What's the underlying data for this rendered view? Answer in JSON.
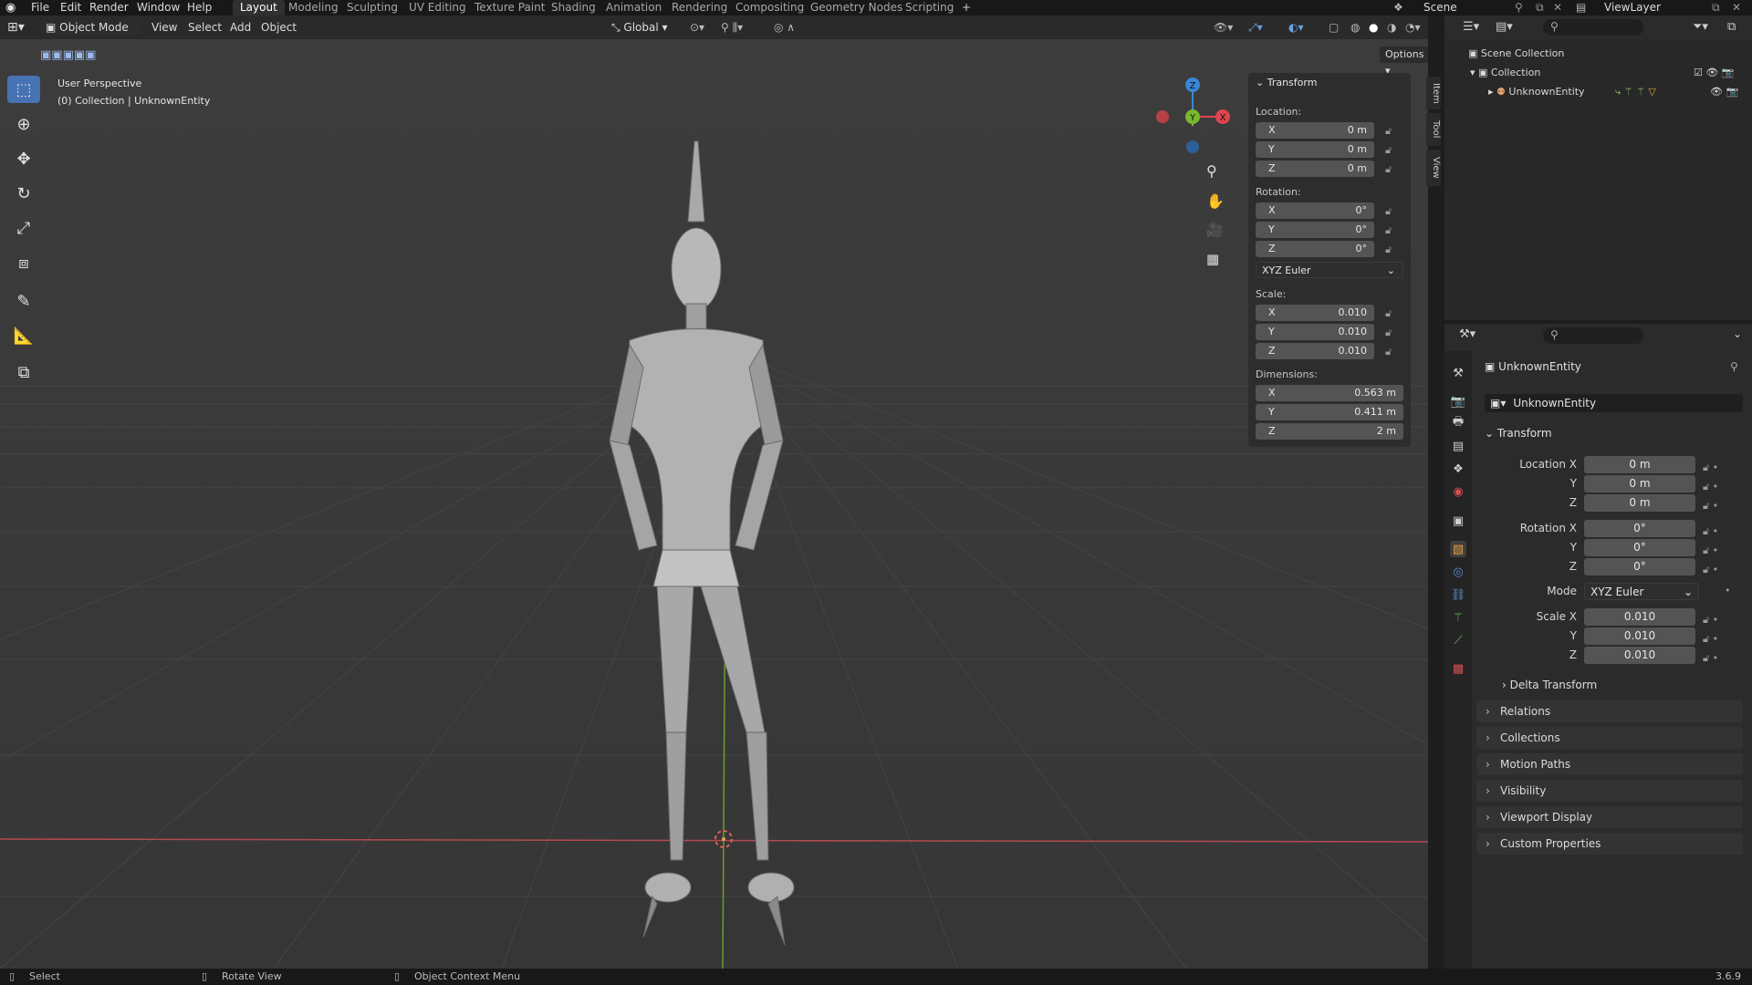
{
  "menu": {
    "items": [
      "File",
      "Edit",
      "Render",
      "Window",
      "Help"
    ],
    "workspaces": [
      "Layout",
      "Modeling",
      "Sculpting",
      "UV Editing",
      "Texture Paint",
      "Shading",
      "Animation",
      "Rendering",
      "Compositing",
      "Geometry Nodes",
      "Scripting"
    ],
    "active_workspace": "Layout",
    "add_tab": "+",
    "scene": "Scene",
    "view_layer": "ViewLayer"
  },
  "viewport_header": {
    "mode": "Object Mode",
    "view": "View",
    "select": "Select",
    "add": "Add",
    "object": "Object",
    "orientation": "Global",
    "options": "Options"
  },
  "viewport": {
    "perspective": "User Perspective",
    "collection_info": "(0) Collection | UnknownEntity"
  },
  "gizmo": {
    "x": "X",
    "y": "Y",
    "z": "Z"
  },
  "npanel": {
    "title": "Transform",
    "location_label": "Location:",
    "location": [
      {
        "axis": "X",
        "val": "0 m"
      },
      {
        "axis": "Y",
        "val": "0 m"
      },
      {
        "axis": "Z",
        "val": "0 m"
      }
    ],
    "rotation_label": "Rotation:",
    "rotation": [
      {
        "axis": "X",
        "val": "0°"
      },
      {
        "axis": "Y",
        "val": "0°"
      },
      {
        "axis": "Z",
        "val": "0°"
      }
    ],
    "rotation_mode": "XYZ Euler",
    "scale_label": "Scale:",
    "scale": [
      {
        "axis": "X",
        "val": "0.010"
      },
      {
        "axis": "Y",
        "val": "0.010"
      },
      {
        "axis": "Z",
        "val": "0.010"
      }
    ],
    "dimensions_label": "Dimensions:",
    "dimensions": [
      {
        "axis": "X",
        "val": "0.563 m"
      },
      {
        "axis": "Y",
        "val": "0.411 m"
      },
      {
        "axis": "Z",
        "val": "2 m"
      }
    ],
    "tabs": [
      "Item",
      "Tool",
      "View"
    ]
  },
  "outliner": {
    "scene_collection": "Scene Collection",
    "collection": "Collection",
    "entity": "UnknownEntity"
  },
  "properties": {
    "object_name": "UnknownEntity",
    "data_name": "UnknownEntity",
    "transform_title": "Transform",
    "location_x_label": "Location X",
    "y_label": "Y",
    "z_label": "Z",
    "location": [
      "0 m",
      "0 m",
      "0 m"
    ],
    "rotation_x_label": "Rotation X",
    "rotation": [
      "0°",
      "0°",
      "0°"
    ],
    "mode_label": "Mode",
    "mode": "XYZ Euler",
    "scale_x_label": "Scale X",
    "scale": [
      "0.010",
      "0.010",
      "0.010"
    ],
    "panels": [
      "Delta Transform",
      "Relations",
      "Collections",
      "Motion Paths",
      "Visibility",
      "Viewport Display",
      "Custom Properties"
    ]
  },
  "status": {
    "select": "Select",
    "rotate": "Rotate View",
    "context": "Object Context Menu",
    "version": "3.6.9"
  },
  "colors": {
    "accent": "#4772b3",
    "x_axis": "#e0454f",
    "y_axis": "#7ab830",
    "z_axis": "#3b86d8"
  }
}
